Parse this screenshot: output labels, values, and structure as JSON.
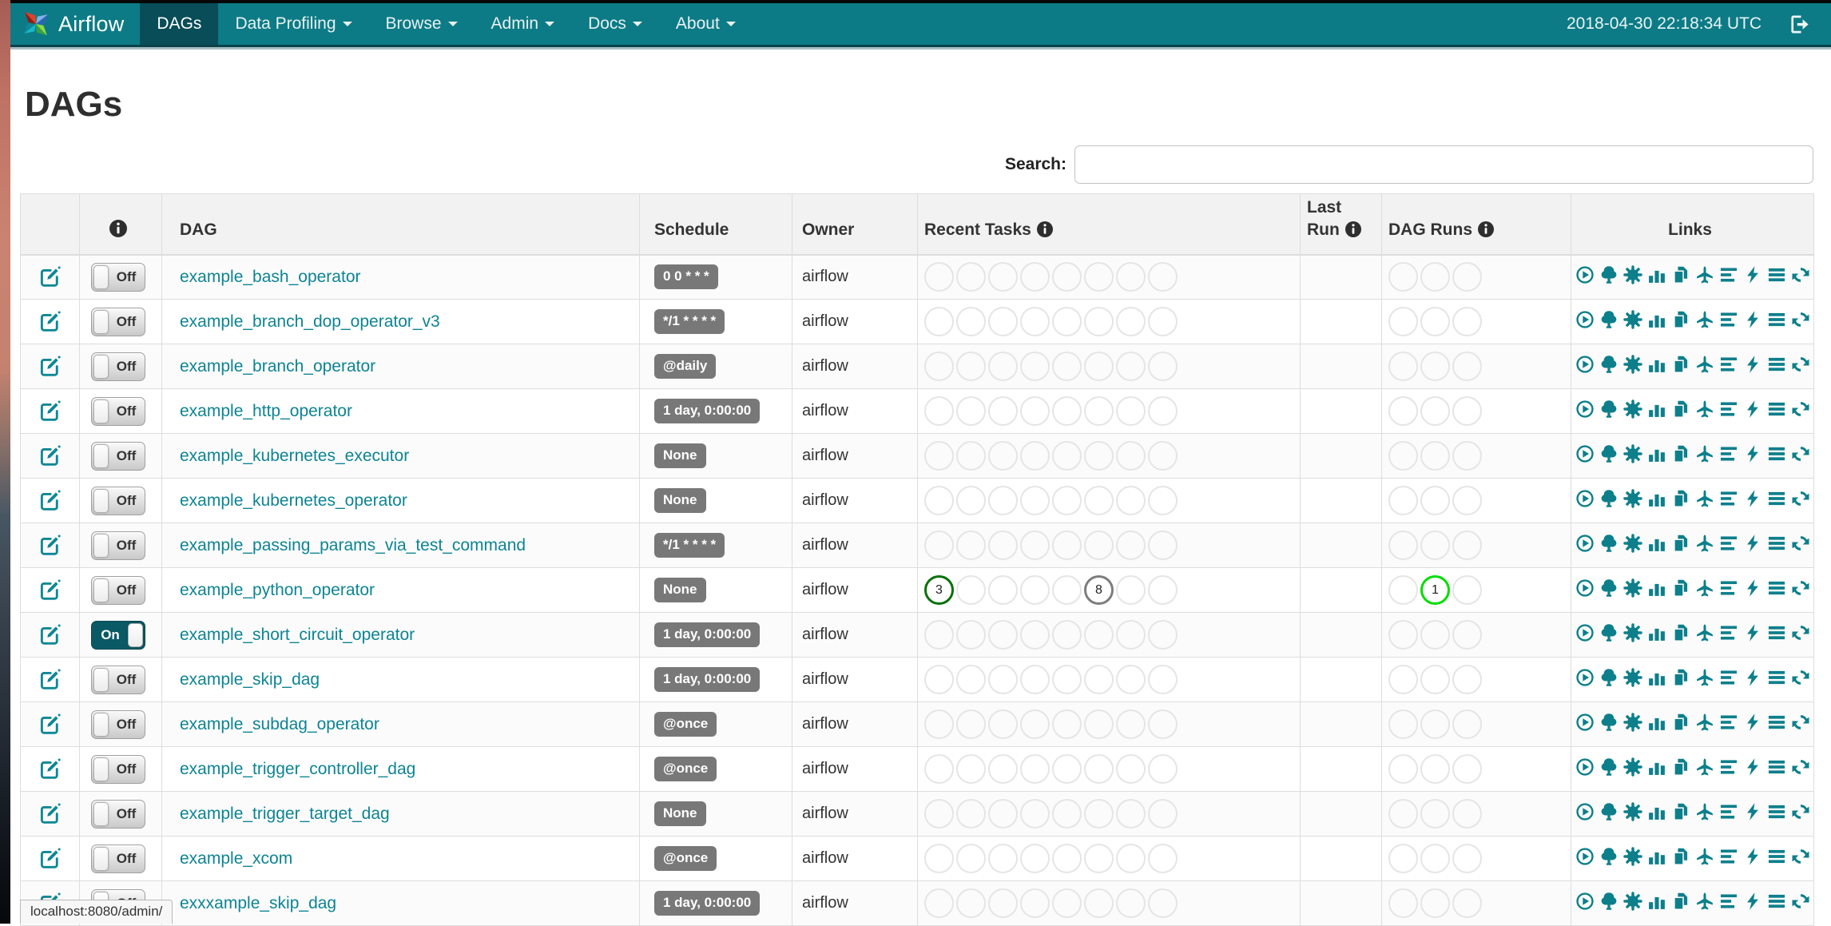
{
  "navbar": {
    "brand": "Airflow",
    "items": [
      {
        "label": "DAGs",
        "active": true,
        "caret": false
      },
      {
        "label": "Data Profiling",
        "active": false,
        "caret": true
      },
      {
        "label": "Browse",
        "active": false,
        "caret": true
      },
      {
        "label": "Admin",
        "active": false,
        "caret": true
      },
      {
        "label": "Docs",
        "active": false,
        "caret": true
      },
      {
        "label": "About",
        "active": false,
        "caret": true
      }
    ],
    "clock": "2018-04-30 22:18:34 UTC"
  },
  "page": {
    "title": "DAGs",
    "search_label": "Search:",
    "search_value": ""
  },
  "colors": {
    "navbar": "#0c7b86",
    "navbar_active": "#084d57",
    "link": "#0d8494",
    "badge_bg": "#787878",
    "icon_teal": "#0d7f8b"
  },
  "state_colors": {
    "success": "#067106",
    "running": "#00dd00",
    "queued": "#7d7d7d"
  },
  "table": {
    "headers": [
      {
        "label": "",
        "info": false,
        "align": "left"
      },
      {
        "label": "",
        "info": true,
        "align": "center"
      },
      {
        "label": "DAG",
        "info": false,
        "align": "left"
      },
      {
        "label": "Schedule",
        "info": false,
        "align": "left"
      },
      {
        "label": "Owner",
        "info": false,
        "align": "left"
      },
      {
        "label": "Recent Tasks",
        "info": true,
        "align": "left"
      },
      {
        "label": "Last Run",
        "info": true,
        "align": "left"
      },
      {
        "label": "DAG Runs",
        "info": true,
        "align": "left"
      },
      {
        "label": "Links",
        "info": false,
        "align": "center"
      }
    ],
    "recent_task_slots": 8,
    "dag_run_slots": 3,
    "link_icons": [
      "trigger-dag",
      "tree-view",
      "graph-view",
      "task-duration",
      "task-tries",
      "landing-times",
      "gantt",
      "code-view",
      "logs",
      "refresh"
    ]
  },
  "dags": [
    {
      "name": "example_bash_operator",
      "toggle": "Off",
      "schedule": "0 0 * * *",
      "owner": "airflow",
      "recent_tasks": [],
      "dag_runs": []
    },
    {
      "name": "example_branch_dop_operator_v3",
      "toggle": "Off",
      "schedule": "*/1 * * * *",
      "owner": "airflow",
      "recent_tasks": [],
      "dag_runs": []
    },
    {
      "name": "example_branch_operator",
      "toggle": "Off",
      "schedule": "@daily",
      "owner": "airflow",
      "recent_tasks": [],
      "dag_runs": []
    },
    {
      "name": "example_http_operator",
      "toggle": "Off",
      "schedule": "1 day, 0:00:00",
      "owner": "airflow",
      "recent_tasks": [],
      "dag_runs": []
    },
    {
      "name": "example_kubernetes_executor",
      "toggle": "Off",
      "schedule": "None",
      "owner": "airflow",
      "recent_tasks": [],
      "dag_runs": []
    },
    {
      "name": "example_kubernetes_operator",
      "toggle": "Off",
      "schedule": "None",
      "owner": "airflow",
      "recent_tasks": [],
      "dag_runs": []
    },
    {
      "name": "example_passing_params_via_test_command",
      "toggle": "Off",
      "schedule": "*/1 * * * *",
      "owner": "airflow",
      "recent_tasks": [],
      "dag_runs": []
    },
    {
      "name": "example_python_operator",
      "toggle": "Off",
      "schedule": "None",
      "owner": "airflow",
      "recent_tasks": [
        {
          "slot": 0,
          "count": 3,
          "state": "success"
        },
        {
          "slot": 5,
          "count": 8,
          "state": "queued"
        }
      ],
      "dag_runs": [
        {
          "slot": 1,
          "count": 1,
          "state": "running"
        }
      ]
    },
    {
      "name": "example_short_circuit_operator",
      "toggle": "On",
      "schedule": "1 day, 0:00:00",
      "owner": "airflow",
      "recent_tasks": [],
      "dag_runs": []
    },
    {
      "name": "example_skip_dag",
      "toggle": "Off",
      "schedule": "1 day, 0:00:00",
      "owner": "airflow",
      "recent_tasks": [],
      "dag_runs": []
    },
    {
      "name": "example_subdag_operator",
      "toggle": "Off",
      "schedule": "@once",
      "owner": "airflow",
      "recent_tasks": [],
      "dag_runs": []
    },
    {
      "name": "example_trigger_controller_dag",
      "toggle": "Off",
      "schedule": "@once",
      "owner": "airflow",
      "recent_tasks": [],
      "dag_runs": []
    },
    {
      "name": "example_trigger_target_dag",
      "toggle": "Off",
      "schedule": "None",
      "owner": "airflow",
      "recent_tasks": [],
      "dag_runs": []
    },
    {
      "name": "example_xcom",
      "toggle": "Off",
      "schedule": "@once",
      "owner": "airflow",
      "recent_tasks": [],
      "dag_runs": []
    },
    {
      "name": "exxxample_skip_dag",
      "toggle": "Off",
      "schedule": "1 day, 0:00:00",
      "owner": "airflow",
      "recent_tasks": [],
      "dag_runs": []
    }
  ],
  "statusbar": {
    "url": "localhost:8080/admin/"
  }
}
